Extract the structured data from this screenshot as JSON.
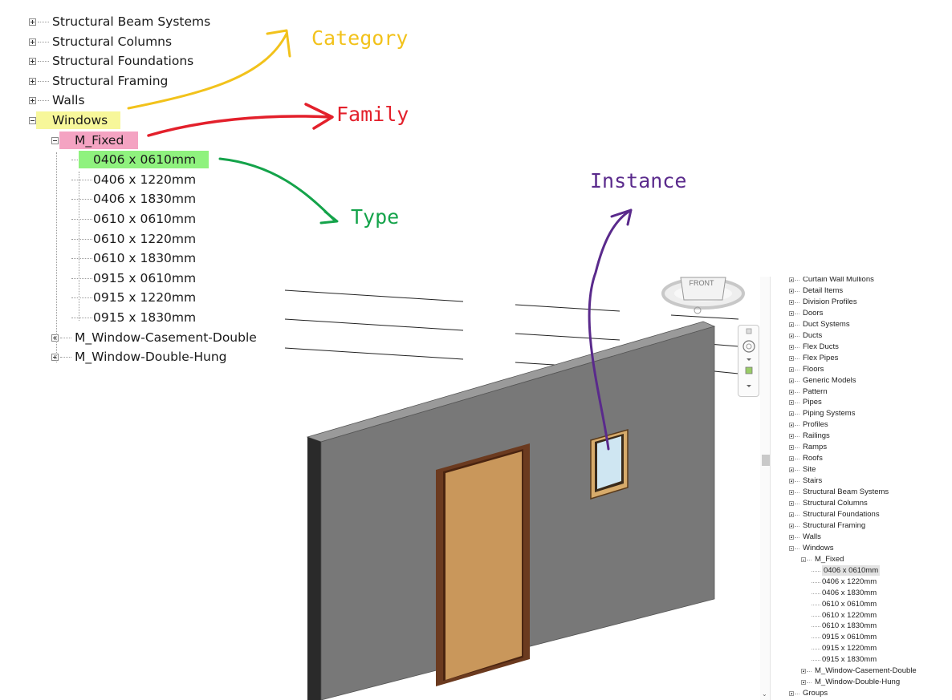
{
  "big_tree": {
    "items": [
      {
        "label": "Structural Beam Systems",
        "indent": 0,
        "expander": "plus",
        "highlight": ""
      },
      {
        "label": "Structural Columns",
        "indent": 0,
        "expander": "plus",
        "highlight": ""
      },
      {
        "label": "Structural Foundations",
        "indent": 0,
        "expander": "plus",
        "highlight": ""
      },
      {
        "label": "Structural Framing",
        "indent": 0,
        "expander": "plus",
        "highlight": ""
      },
      {
        "label": "Walls",
        "indent": 0,
        "expander": "plus",
        "highlight": ""
      },
      {
        "label": "Windows",
        "indent": 0,
        "expander": "minus",
        "highlight": "yellow"
      },
      {
        "label": "M_Fixed",
        "indent": 1,
        "expander": "minus",
        "highlight": "pink"
      },
      {
        "label": "0406 x 0610mm",
        "indent": 2,
        "expander": "",
        "highlight": "green"
      },
      {
        "label": "0406 x 1220mm",
        "indent": 2,
        "expander": "",
        "highlight": ""
      },
      {
        "label": "0406 x 1830mm",
        "indent": 2,
        "expander": "",
        "highlight": ""
      },
      {
        "label": "0610 x 0610mm",
        "indent": 2,
        "expander": "",
        "highlight": ""
      },
      {
        "label": "0610 x 1220mm",
        "indent": 2,
        "expander": "",
        "highlight": ""
      },
      {
        "label": "0610 x 1830mm",
        "indent": 2,
        "expander": "",
        "highlight": ""
      },
      {
        "label": "0915 x 0610mm",
        "indent": 2,
        "expander": "",
        "highlight": ""
      },
      {
        "label": "0915 x 1220mm",
        "indent": 2,
        "expander": "",
        "highlight": ""
      },
      {
        "label": "0915 x 1830mm",
        "indent": 2,
        "expander": "",
        "highlight": ""
      },
      {
        "label": "M_Window-Casement-Double",
        "indent": 1,
        "expander": "plus",
        "highlight": ""
      },
      {
        "label": "M_Window-Double-Hung",
        "indent": 1,
        "expander": "plus",
        "highlight": ""
      }
    ]
  },
  "annotations": {
    "category": {
      "text": "Category",
      "color": "#f2c21b"
    },
    "family": {
      "text": "Family",
      "color": "#e3202b"
    },
    "type": {
      "text": "Type",
      "color": "#14a34a"
    },
    "instance": {
      "text": "Instance",
      "color": "#5a2a8c"
    }
  },
  "viewcube": {
    "face_label": "FRONT"
  },
  "model": {
    "wall_color": "#787878",
    "door_color": "#c9975b",
    "frame_color": "#6b3a1f"
  },
  "small_tree": {
    "items": [
      {
        "label": "Curtain Wall Mullions",
        "indent": 0,
        "expander": "plus",
        "selected": false
      },
      {
        "label": "Detail Items",
        "indent": 0,
        "expander": "plus",
        "selected": false
      },
      {
        "label": "Division Profiles",
        "indent": 0,
        "expander": "plus",
        "selected": false
      },
      {
        "label": "Doors",
        "indent": 0,
        "expander": "plus",
        "selected": false
      },
      {
        "label": "Duct Systems",
        "indent": 0,
        "expander": "plus",
        "selected": false
      },
      {
        "label": "Ducts",
        "indent": 0,
        "expander": "plus",
        "selected": false
      },
      {
        "label": "Flex Ducts",
        "indent": 0,
        "expander": "plus",
        "selected": false
      },
      {
        "label": "Flex Pipes",
        "indent": 0,
        "expander": "plus",
        "selected": false
      },
      {
        "label": "Floors",
        "indent": 0,
        "expander": "plus",
        "selected": false
      },
      {
        "label": "Generic Models",
        "indent": 0,
        "expander": "plus",
        "selected": false
      },
      {
        "label": "Pattern",
        "indent": 0,
        "expander": "plus",
        "selected": false
      },
      {
        "label": "Pipes",
        "indent": 0,
        "expander": "plus",
        "selected": false
      },
      {
        "label": "Piping Systems",
        "indent": 0,
        "expander": "plus",
        "selected": false
      },
      {
        "label": "Profiles",
        "indent": 0,
        "expander": "plus",
        "selected": false
      },
      {
        "label": "Railings",
        "indent": 0,
        "expander": "plus",
        "selected": false
      },
      {
        "label": "Ramps",
        "indent": 0,
        "expander": "plus",
        "selected": false
      },
      {
        "label": "Roofs",
        "indent": 0,
        "expander": "plus",
        "selected": false
      },
      {
        "label": "Site",
        "indent": 0,
        "expander": "plus",
        "selected": false
      },
      {
        "label": "Stairs",
        "indent": 0,
        "expander": "plus",
        "selected": false
      },
      {
        "label": "Structural Beam Systems",
        "indent": 0,
        "expander": "plus",
        "selected": false
      },
      {
        "label": "Structural Columns",
        "indent": 0,
        "expander": "plus",
        "selected": false
      },
      {
        "label": "Structural Foundations",
        "indent": 0,
        "expander": "plus",
        "selected": false
      },
      {
        "label": "Structural Framing",
        "indent": 0,
        "expander": "plus",
        "selected": false
      },
      {
        "label": "Walls",
        "indent": 0,
        "expander": "plus",
        "selected": false
      },
      {
        "label": "Windows",
        "indent": 0,
        "expander": "minus",
        "selected": false
      },
      {
        "label": "M_Fixed",
        "indent": 1,
        "expander": "minus",
        "selected": false
      },
      {
        "label": "0406 x 0610mm",
        "indent": 2,
        "expander": "",
        "selected": true
      },
      {
        "label": "0406 x 1220mm",
        "indent": 2,
        "expander": "",
        "selected": false
      },
      {
        "label": "0406 x 1830mm",
        "indent": 2,
        "expander": "",
        "selected": false
      },
      {
        "label": "0610 x 0610mm",
        "indent": 2,
        "expander": "",
        "selected": false
      },
      {
        "label": "0610 x 1220mm",
        "indent": 2,
        "expander": "",
        "selected": false
      },
      {
        "label": "0610 x 1830mm",
        "indent": 2,
        "expander": "",
        "selected": false
      },
      {
        "label": "0915 x 0610mm",
        "indent": 2,
        "expander": "",
        "selected": false
      },
      {
        "label": "0915 x 1220mm",
        "indent": 2,
        "expander": "",
        "selected": false
      },
      {
        "label": "0915 x 1830mm",
        "indent": 2,
        "expander": "",
        "selected": false
      },
      {
        "label": "M_Window-Casement-Double",
        "indent": 1,
        "expander": "plus",
        "selected": false
      },
      {
        "label": "M_Window-Double-Hung",
        "indent": 1,
        "expander": "plus",
        "selected": false
      },
      {
        "label": "Groups",
        "indent": 0,
        "expander": "plus",
        "selected": false
      }
    ]
  }
}
